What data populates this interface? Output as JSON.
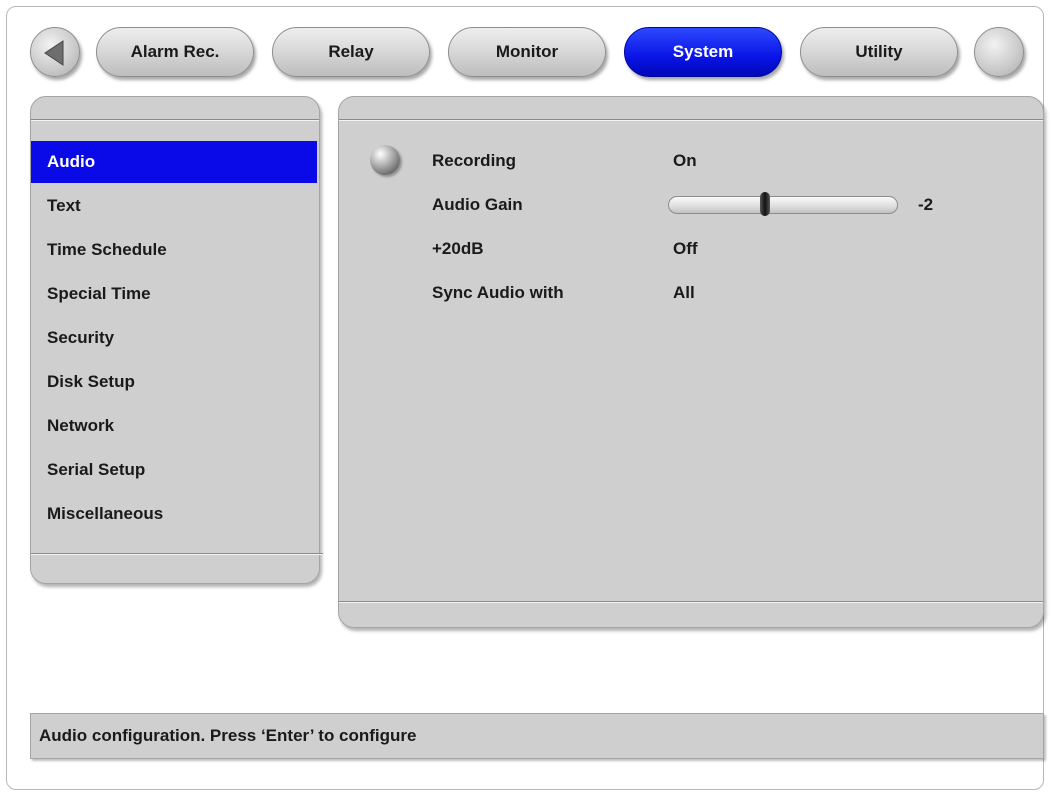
{
  "tabs": [
    {
      "label": "Alarm Rec.",
      "active": false
    },
    {
      "label": "Relay",
      "active": false
    },
    {
      "label": "Monitor",
      "active": false
    },
    {
      "label": "System",
      "active": true
    },
    {
      "label": "Utility",
      "active": false
    }
  ],
  "sidebar": {
    "items": [
      {
        "label": "Audio",
        "selected": true
      },
      {
        "label": "Text"
      },
      {
        "label": "Time Schedule"
      },
      {
        "label": "Special Time"
      },
      {
        "label": "Security"
      },
      {
        "label": "Disk Setup"
      },
      {
        "label": "Network"
      },
      {
        "label": "Serial Setup"
      },
      {
        "label": "Miscellaneous"
      }
    ]
  },
  "settings": {
    "recording": {
      "label": "Recording",
      "value": "On"
    },
    "audio_gain": {
      "label": "Audio Gain",
      "value": "-2",
      "slider_fraction": 0.42
    },
    "boost": {
      "label": "+20dB",
      "value": "Off"
    },
    "sync": {
      "label": "Sync Audio with",
      "value": "All"
    }
  },
  "status": {
    "text": "Audio configuration. Press ‘Enter’ to configure"
  },
  "colors": {
    "accent": "#0a0ae8",
    "panel": "#cfcfcf"
  },
  "icons": {
    "prev": "left-arrow-icon",
    "next": "next-icon",
    "bullet": "sphere-bullet-icon"
  }
}
